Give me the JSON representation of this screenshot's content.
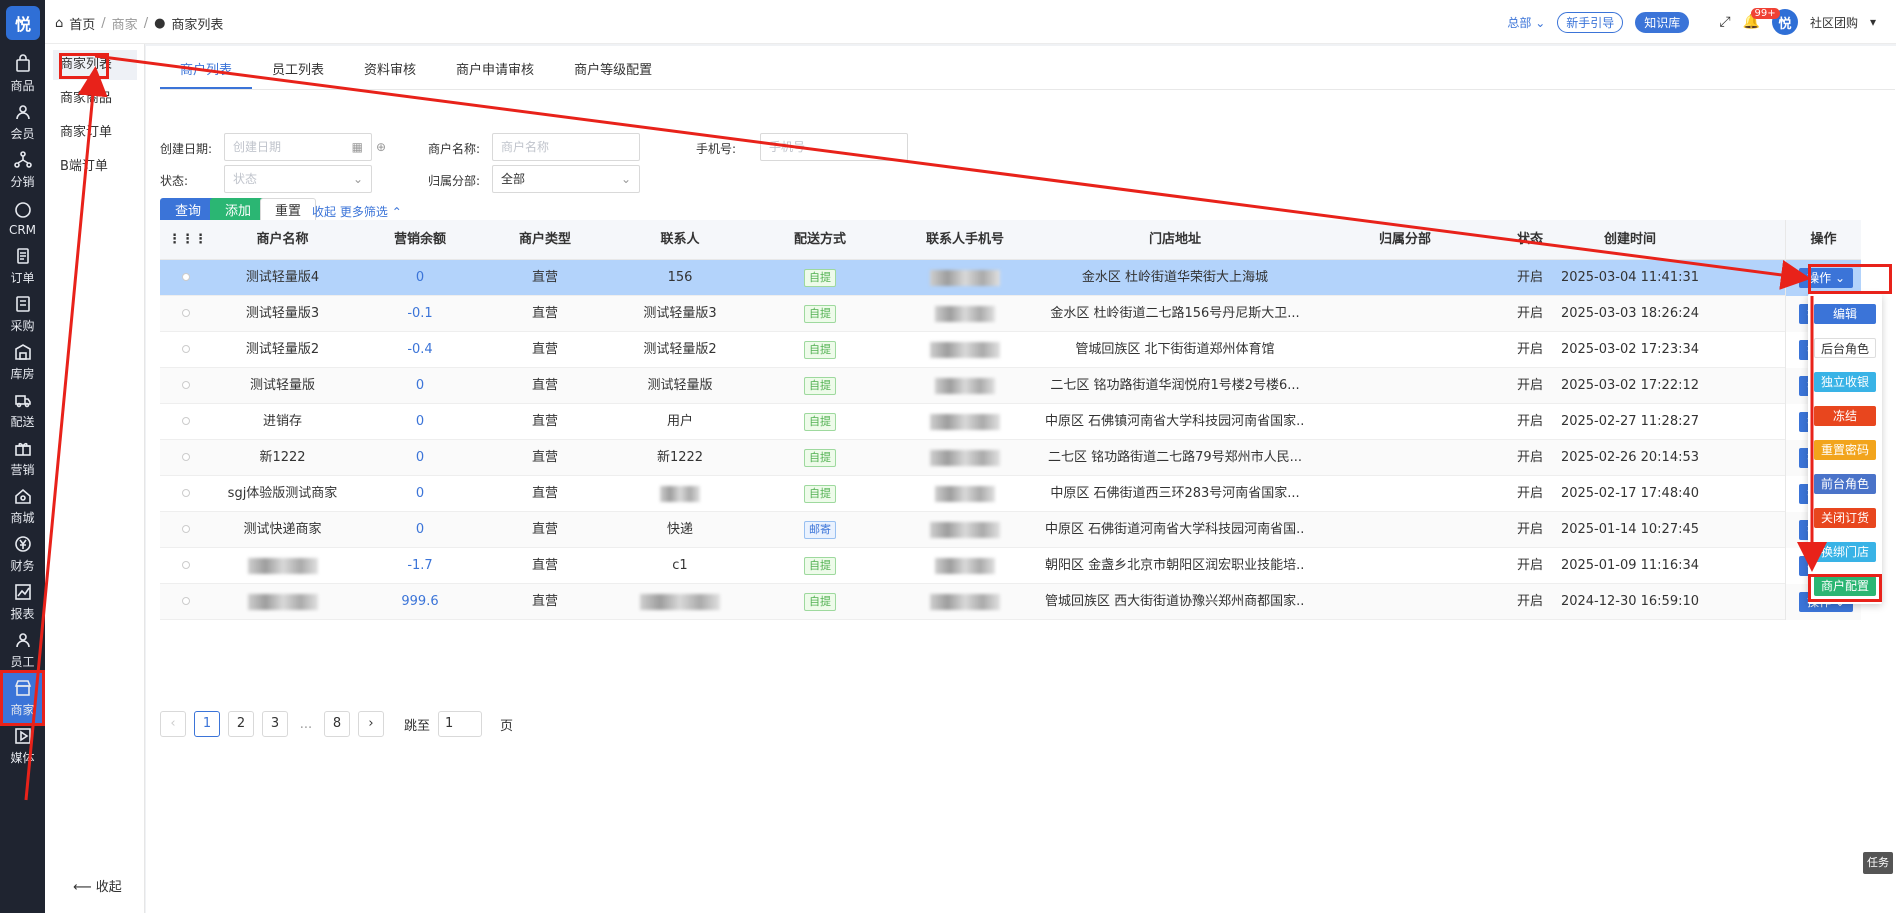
{
  "logo_text": "悦",
  "sidebar": {
    "items": [
      {
        "label": "商品",
        "icon": "bag-icon"
      },
      {
        "label": "会员",
        "icon": "user-icon"
      },
      {
        "label": "分销",
        "icon": "share-icon"
      },
      {
        "label": "CRM",
        "icon": "crm-icon"
      },
      {
        "label": "订单",
        "icon": "order-icon"
      },
      {
        "label": "采购",
        "icon": "purchase-icon"
      },
      {
        "label": "库房",
        "icon": "warehouse-icon"
      },
      {
        "label": "配送",
        "icon": "truck-icon"
      },
      {
        "label": "营销",
        "icon": "gift-icon"
      },
      {
        "label": "商城",
        "icon": "home-icon"
      },
      {
        "label": "财务",
        "icon": "yen-icon"
      },
      {
        "label": "报表",
        "icon": "chart-icon"
      },
      {
        "label": "员工",
        "icon": "staff-icon"
      },
      {
        "label": "商家",
        "icon": "store-icon"
      },
      {
        "label": "媒体",
        "icon": "media-icon"
      }
    ]
  },
  "submenu": {
    "items": [
      "商家列表",
      "商家商品",
      "商家订单",
      "B端订单"
    ],
    "collapse": "收起"
  },
  "breadcrumb": {
    "home": "首页",
    "level1": "商家",
    "current": "商家列表"
  },
  "topbar": {
    "org": "总部",
    "guide": "新手引导",
    "knowledge": "知识库",
    "badge": "99+",
    "user": "社区团购"
  },
  "tabs": [
    "商户列表",
    "员工列表",
    "资料审核",
    "商户申请审核",
    "商户等级配置"
  ],
  "filters": {
    "create_date_label": "创建日期:",
    "create_date_placeholder": "创建日期",
    "merchant_name_label": "商户名称:",
    "merchant_name_placeholder": "商户名称",
    "phone_label": "手机号:",
    "phone_placeholder": "手机号",
    "status_label": "状态:",
    "status_placeholder": "状态",
    "branch_label": "归属分部:",
    "branch_value": "全部"
  },
  "buttons": {
    "query": "查询",
    "add": "添加",
    "reset": "重置",
    "collapse": "收起",
    "more": "更多筛选"
  },
  "table": {
    "headers": [
      "商户名称",
      "营销余额",
      "商户类型",
      "联系人",
      "配送方式",
      "联系人手机号",
      "门店地址",
      "归属分部",
      "状态",
      "创建时间",
      "操作"
    ],
    "rows": [
      {
        "name": "测试轻量版4",
        "balance": "0",
        "type": "直营",
        "contact": "156",
        "delivery": "自提",
        "address": "金水区 杜岭街道华荣街大上海城",
        "status": "开启",
        "created": "2025-03-04 11:41:31",
        "op": "操作"
      },
      {
        "name": "测试轻量版3",
        "balance": "-0.1",
        "type": "直营",
        "contact": "测试轻量版3",
        "delivery": "自提",
        "address": "金水区 杜岭街道二七路156号丹尼斯大卫...",
        "status": "开启",
        "created": "2025-03-03 18:26:24",
        "op": "操作"
      },
      {
        "name": "测试轻量版2",
        "balance": "-0.4",
        "type": "直营",
        "contact": "测试轻量版2",
        "delivery": "自提",
        "address": "管城回族区 北下街街道郑州体育馆",
        "status": "开启",
        "created": "2025-03-02 17:23:34",
        "op": "操作"
      },
      {
        "name": "测试轻量版",
        "balance": "0",
        "type": "直营",
        "contact": "测试轻量版",
        "delivery": "自提",
        "address": "二七区 铭功路街道华润悦府1号楼2号楼6...",
        "status": "开启",
        "created": "2025-03-02 17:22:12",
        "op": "操作"
      },
      {
        "name": "进销存",
        "balance": "0",
        "type": "直营",
        "contact": "用户",
        "delivery": "自提",
        "address": "中原区 石佛镇河南省大学科技园河南省国家...",
        "status": "开启",
        "created": "2025-02-27 11:28:27",
        "op": "操作"
      },
      {
        "name": "新1222",
        "balance": "0",
        "type": "直营",
        "contact": "新1222",
        "delivery": "自提",
        "address": "二七区 铭功路街道二七路79号郑州市人民...",
        "status": "开启",
        "created": "2025-02-26 20:14:53",
        "op": "操作"
      },
      {
        "name": "sgj体验版测试商家",
        "balance": "0",
        "type": "直营",
        "contact": "",
        "delivery": "自提",
        "address": "中原区 石佛街道西三环283号河南省国家...",
        "status": "开启",
        "created": "2025-02-17 17:48:40",
        "op": "操作"
      },
      {
        "name": "测试快递商家",
        "balance": "0",
        "type": "直营",
        "contact": "快递",
        "delivery": "邮寄",
        "address": "中原区 石佛街道河南省大学科技园河南省国...",
        "status": "开启",
        "created": "2025-01-14 10:27:45",
        "op": "操作"
      },
      {
        "name": "",
        "balance": "-1.7",
        "type": "直营",
        "contact": "c1",
        "delivery": "自提",
        "address": "朝阳区 金盏乡北京市朝阳区润宏职业技能培...",
        "status": "开启",
        "created": "2025-01-09 11:16:34",
        "op": "操作"
      },
      {
        "name": "",
        "balance": "999.6",
        "type": "直营",
        "contact": "",
        "delivery": "自提",
        "address": "管城回族区 西大街街道协豫兴郑州商都国家...",
        "status": "开启",
        "created": "2024-12-30 16:59:10",
        "op": "操作"
      }
    ]
  },
  "dropdown": {
    "items": [
      {
        "label": "编辑",
        "color": "#3b74d8"
      },
      {
        "label": "后台角色",
        "color": "#ffffff"
      },
      {
        "label": "独立收银",
        "color": "#39b3e6"
      },
      {
        "label": "冻结",
        "color": "#e8461e"
      },
      {
        "label": "重置密码",
        "color": "#f2a41c"
      },
      {
        "label": "前台角色",
        "color": "#4a73c9"
      },
      {
        "label": "关闭订货",
        "color": "#e8461e"
      },
      {
        "label": "换绑门店",
        "color": "#39b3e6"
      },
      {
        "label": "商户配置",
        "color": "#2bb673"
      }
    ]
  },
  "pager": {
    "pages": [
      "1",
      "2",
      "3",
      "...",
      "8"
    ],
    "jump_label": "跳至",
    "jump_value": "1",
    "page_suffix": "页"
  },
  "task_label": "任务"
}
